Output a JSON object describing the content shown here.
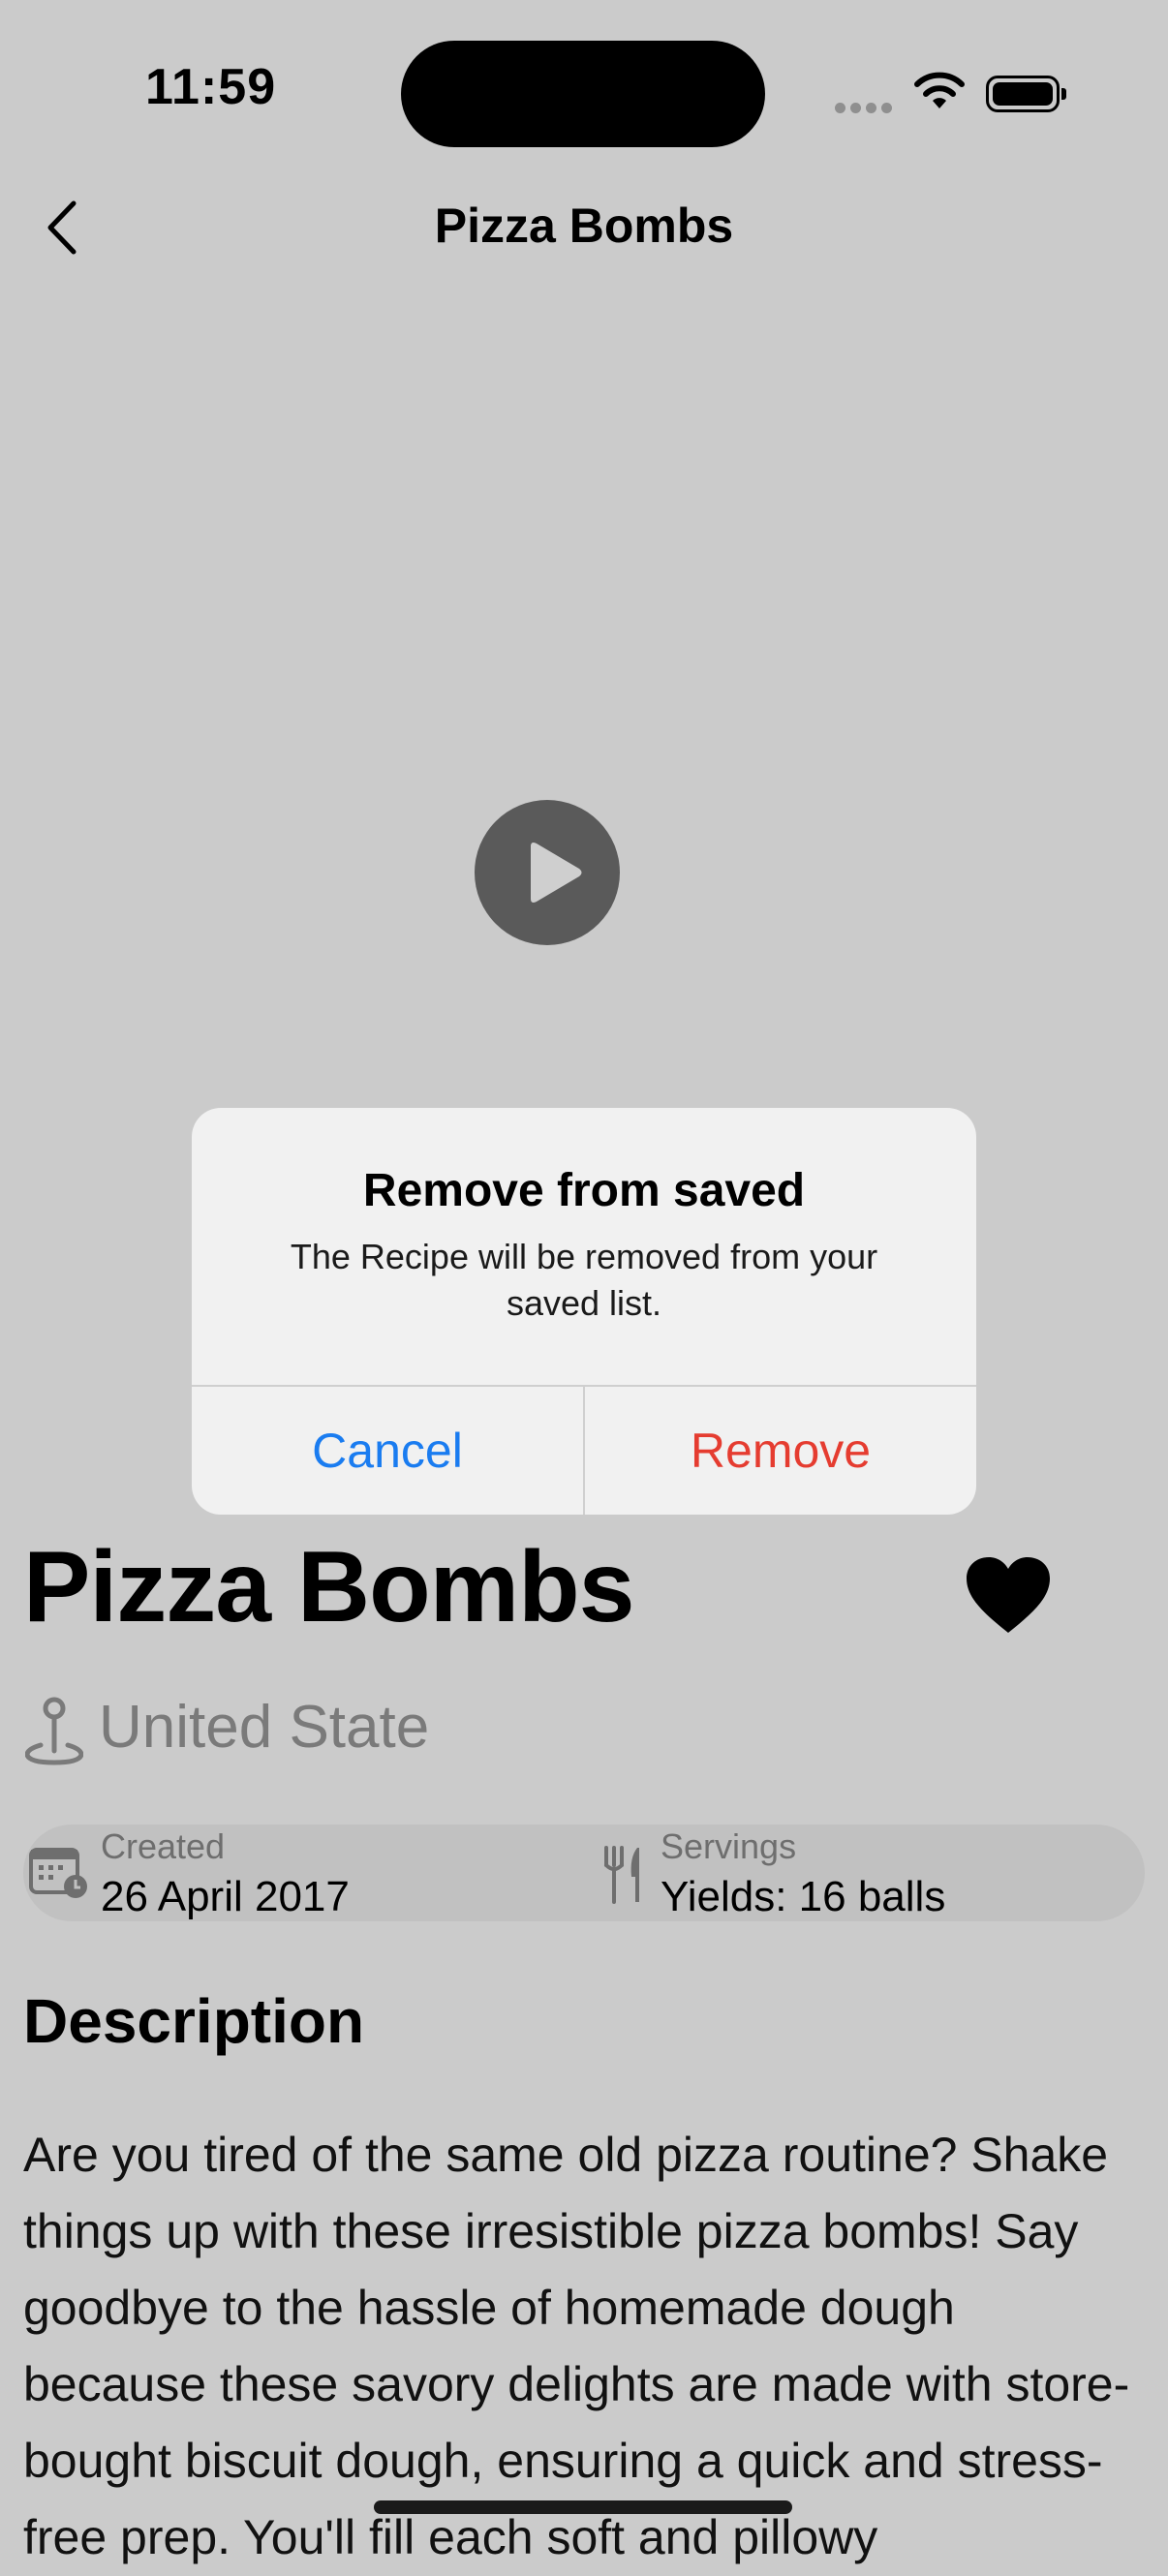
{
  "status_bar": {
    "time": "11:59"
  },
  "nav": {
    "title": "Pizza Bombs"
  },
  "recipe": {
    "title": "Pizza Bombs",
    "country": "United State",
    "created_label": "Created",
    "created_value": "26 April 2017",
    "servings_label": "Servings",
    "servings_value": "Yields: 16 balls",
    "description_heading": "Description",
    "description_text": "Are you tired of the same old pizza routine? Shake things up with these irresistible pizza bombs! Say goodbye to the hassle of homemade dough because these savory delights are made with store-bought biscuit dough, ensuring a quick and stress-free prep. You'll fill each soft and pillowy"
  },
  "alert": {
    "title": "Remove from saved",
    "message": "The Recipe will be removed from your saved list.",
    "cancel_label": "Cancel",
    "remove_label": "Remove"
  },
  "colors": {
    "alert_cancel": "#1a7cf0",
    "alert_remove": "#e53c30",
    "dim_background": "#cbcbcb"
  },
  "icons": [
    "chevron-left-icon",
    "play-icon",
    "heart-icon",
    "location-pin-icon",
    "calendar-icon",
    "fork-knife-icon",
    "wifi-icon",
    "battery-icon"
  ]
}
